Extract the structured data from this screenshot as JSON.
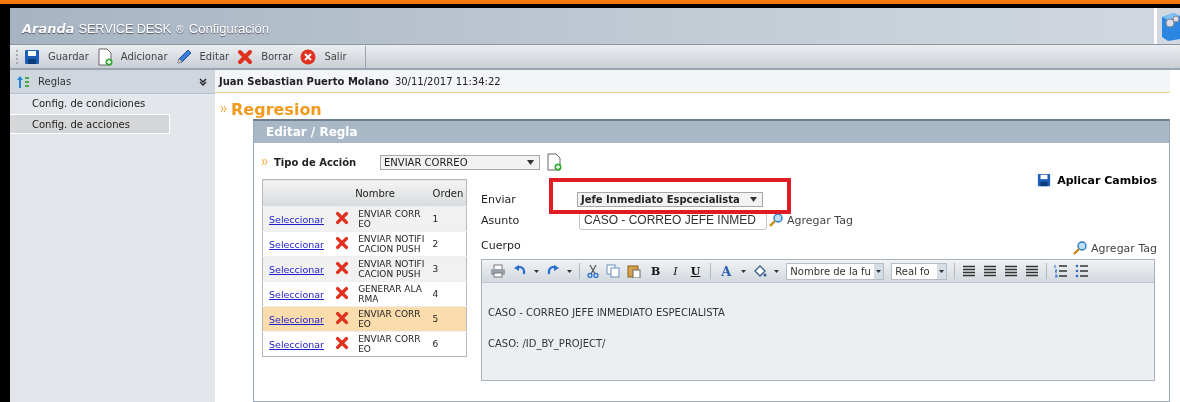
{
  "app": {
    "brand": "Aranda",
    "product": "SERVICE DESK",
    "mark": "®",
    "section": "Configuración"
  },
  "toolbar": [
    {
      "kind": "save",
      "label": "Guardar"
    },
    {
      "kind": "add",
      "label": "Adicionar"
    },
    {
      "kind": "edit",
      "label": "Editar"
    },
    {
      "kind": "delete",
      "label": "Borrar"
    },
    {
      "kind": "exit",
      "label": "Salir"
    }
  ],
  "sidebar": {
    "title": "Reglas",
    "items": [
      {
        "label": "Config. de condiciones",
        "selected": false
      },
      {
        "label": "Config. de acciones",
        "selected": true
      }
    ]
  },
  "user_bar": {
    "user": "Juan Sebastian Puerto Molano",
    "datetime": "30/11/2017 11:34:22"
  },
  "page_title": "Regresion",
  "panel": {
    "title": "Editar / Regla",
    "action_type": {
      "label": "Tipo de Acción",
      "value": "ENVIAR CORREO"
    },
    "table": {
      "columns": [
        "Nombre",
        "Orden"
      ],
      "rows": [
        {
          "link": "Seleccionar",
          "name": "ENVIAR CORREO",
          "order": "1",
          "selected": false
        },
        {
          "link": "Seleccionar",
          "name": "ENVIAR NOTIFICACION PUSH",
          "order": "2",
          "selected": false
        },
        {
          "link": "Seleccionar",
          "name": "ENVIAR NOTIFICACION PUSH",
          "order": "3",
          "selected": false
        },
        {
          "link": "Seleccionar",
          "name": "GENERAR ALARMA",
          "order": "4",
          "selected": false
        },
        {
          "link": "Seleccionar",
          "name": "ENVIAR CORREO",
          "order": "5",
          "selected": true
        },
        {
          "link": "Seleccionar",
          "name": "ENVIAR CORREO",
          "order": "6",
          "selected": false
        }
      ]
    },
    "apply_button": "Aplicar Cambios",
    "form": {
      "send": {
        "label": "Enviar",
        "value": "Jefe Inmediato Espcecialista",
        "highlighted": true
      },
      "subject": {
        "label": "Asunto",
        "value": "CASO - CORREO JEFE INMED",
        "tag_link": "Agregar Tag"
      },
      "body": {
        "label": "Cuerpo",
        "tag_link": "Agregar Tag",
        "tools": [
          {
            "kind": "print"
          },
          {
            "kind": "undo"
          },
          {
            "kind": "caret"
          },
          {
            "kind": "redo"
          },
          {
            "kind": "caret"
          },
          {
            "kind": "sep"
          },
          {
            "kind": "cut"
          },
          {
            "kind": "copy"
          },
          {
            "kind": "paste"
          },
          {
            "kind": "bold",
            "label": "B"
          },
          {
            "kind": "italic",
            "label": "I"
          },
          {
            "kind": "underline",
            "label": "U"
          },
          {
            "kind": "sep"
          },
          {
            "kind": "color",
            "label": "A"
          },
          {
            "kind": "caret"
          },
          {
            "kind": "fill"
          },
          {
            "kind": "caret"
          },
          {
            "kind": "select",
            "label": "Nombre de la fu",
            "wide": true
          },
          {
            "kind": "select",
            "label": "Real fo",
            "wide": false
          },
          {
            "kind": "sep"
          },
          {
            "kind": "align"
          },
          {
            "kind": "align"
          },
          {
            "kind": "align"
          },
          {
            "kind": "align"
          },
          {
            "kind": "sep"
          },
          {
            "kind": "olist"
          },
          {
            "kind": "ulist"
          }
        ],
        "lines": [
          "CASO - CORREO JEFE INMEDIATO ESPECIALISTA",
          "CASO: /ID_BY_PROJECT/"
        ]
      }
    }
  }
}
